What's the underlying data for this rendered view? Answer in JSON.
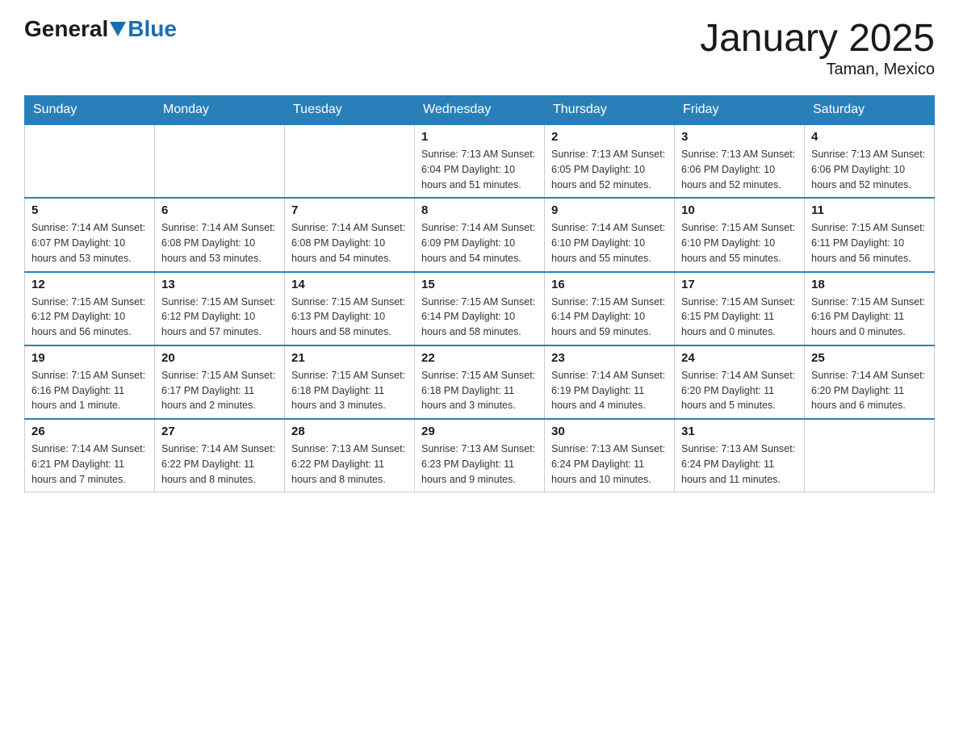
{
  "header": {
    "logo_general": "General",
    "logo_blue": "Blue",
    "title": "January 2025",
    "subtitle": "Taman, Mexico"
  },
  "days_of_week": [
    "Sunday",
    "Monday",
    "Tuesday",
    "Wednesday",
    "Thursday",
    "Friday",
    "Saturday"
  ],
  "weeks": [
    [
      {
        "day": "",
        "info": ""
      },
      {
        "day": "",
        "info": ""
      },
      {
        "day": "",
        "info": ""
      },
      {
        "day": "1",
        "info": "Sunrise: 7:13 AM\nSunset: 6:04 PM\nDaylight: 10 hours and 51 minutes."
      },
      {
        "day": "2",
        "info": "Sunrise: 7:13 AM\nSunset: 6:05 PM\nDaylight: 10 hours and 52 minutes."
      },
      {
        "day": "3",
        "info": "Sunrise: 7:13 AM\nSunset: 6:06 PM\nDaylight: 10 hours and 52 minutes."
      },
      {
        "day": "4",
        "info": "Sunrise: 7:13 AM\nSunset: 6:06 PM\nDaylight: 10 hours and 52 minutes."
      }
    ],
    [
      {
        "day": "5",
        "info": "Sunrise: 7:14 AM\nSunset: 6:07 PM\nDaylight: 10 hours and 53 minutes."
      },
      {
        "day": "6",
        "info": "Sunrise: 7:14 AM\nSunset: 6:08 PM\nDaylight: 10 hours and 53 minutes."
      },
      {
        "day": "7",
        "info": "Sunrise: 7:14 AM\nSunset: 6:08 PM\nDaylight: 10 hours and 54 minutes."
      },
      {
        "day": "8",
        "info": "Sunrise: 7:14 AM\nSunset: 6:09 PM\nDaylight: 10 hours and 54 minutes."
      },
      {
        "day": "9",
        "info": "Sunrise: 7:14 AM\nSunset: 6:10 PM\nDaylight: 10 hours and 55 minutes."
      },
      {
        "day": "10",
        "info": "Sunrise: 7:15 AM\nSunset: 6:10 PM\nDaylight: 10 hours and 55 minutes."
      },
      {
        "day": "11",
        "info": "Sunrise: 7:15 AM\nSunset: 6:11 PM\nDaylight: 10 hours and 56 minutes."
      }
    ],
    [
      {
        "day": "12",
        "info": "Sunrise: 7:15 AM\nSunset: 6:12 PM\nDaylight: 10 hours and 56 minutes."
      },
      {
        "day": "13",
        "info": "Sunrise: 7:15 AM\nSunset: 6:12 PM\nDaylight: 10 hours and 57 minutes."
      },
      {
        "day": "14",
        "info": "Sunrise: 7:15 AM\nSunset: 6:13 PM\nDaylight: 10 hours and 58 minutes."
      },
      {
        "day": "15",
        "info": "Sunrise: 7:15 AM\nSunset: 6:14 PM\nDaylight: 10 hours and 58 minutes."
      },
      {
        "day": "16",
        "info": "Sunrise: 7:15 AM\nSunset: 6:14 PM\nDaylight: 10 hours and 59 minutes."
      },
      {
        "day": "17",
        "info": "Sunrise: 7:15 AM\nSunset: 6:15 PM\nDaylight: 11 hours and 0 minutes."
      },
      {
        "day": "18",
        "info": "Sunrise: 7:15 AM\nSunset: 6:16 PM\nDaylight: 11 hours and 0 minutes."
      }
    ],
    [
      {
        "day": "19",
        "info": "Sunrise: 7:15 AM\nSunset: 6:16 PM\nDaylight: 11 hours and 1 minute."
      },
      {
        "day": "20",
        "info": "Sunrise: 7:15 AM\nSunset: 6:17 PM\nDaylight: 11 hours and 2 minutes."
      },
      {
        "day": "21",
        "info": "Sunrise: 7:15 AM\nSunset: 6:18 PM\nDaylight: 11 hours and 3 minutes."
      },
      {
        "day": "22",
        "info": "Sunrise: 7:15 AM\nSunset: 6:18 PM\nDaylight: 11 hours and 3 minutes."
      },
      {
        "day": "23",
        "info": "Sunrise: 7:14 AM\nSunset: 6:19 PM\nDaylight: 11 hours and 4 minutes."
      },
      {
        "day": "24",
        "info": "Sunrise: 7:14 AM\nSunset: 6:20 PM\nDaylight: 11 hours and 5 minutes."
      },
      {
        "day": "25",
        "info": "Sunrise: 7:14 AM\nSunset: 6:20 PM\nDaylight: 11 hours and 6 minutes."
      }
    ],
    [
      {
        "day": "26",
        "info": "Sunrise: 7:14 AM\nSunset: 6:21 PM\nDaylight: 11 hours and 7 minutes."
      },
      {
        "day": "27",
        "info": "Sunrise: 7:14 AM\nSunset: 6:22 PM\nDaylight: 11 hours and 8 minutes."
      },
      {
        "day": "28",
        "info": "Sunrise: 7:13 AM\nSunset: 6:22 PM\nDaylight: 11 hours and 8 minutes."
      },
      {
        "day": "29",
        "info": "Sunrise: 7:13 AM\nSunset: 6:23 PM\nDaylight: 11 hours and 9 minutes."
      },
      {
        "day": "30",
        "info": "Sunrise: 7:13 AM\nSunset: 6:24 PM\nDaylight: 11 hours and 10 minutes."
      },
      {
        "day": "31",
        "info": "Sunrise: 7:13 AM\nSunset: 6:24 PM\nDaylight: 11 hours and 11 minutes."
      },
      {
        "day": "",
        "info": ""
      }
    ]
  ]
}
